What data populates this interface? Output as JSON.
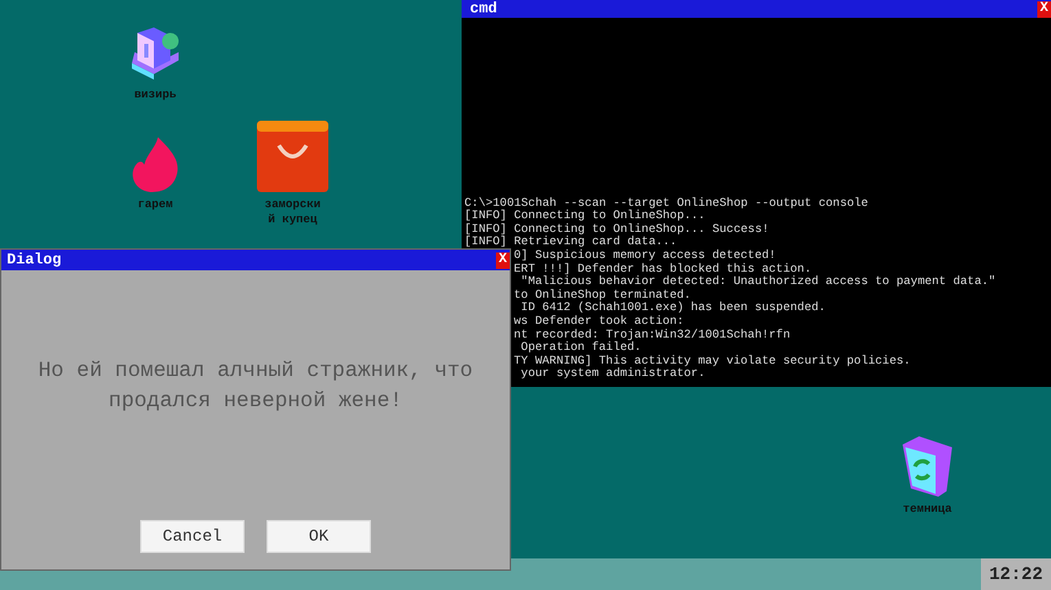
{
  "desktop_icons": [
    {
      "kind": "computer",
      "label": "визирь"
    },
    {
      "kind": "flame",
      "label": "гарем"
    },
    {
      "kind": "bag",
      "label": "заморский купец"
    },
    {
      "kind": "bin",
      "label": "темница"
    }
  ],
  "cmd_window": {
    "title": "cmd",
    "close": "X",
    "lines": [
      {
        "kind": "full",
        "text": "C:\\>1001Schah --scan --target OnlineShop --output console"
      },
      {
        "kind": "full",
        "text": "[INFO] Connecting to OnlineShop..."
      },
      {
        "kind": "full",
        "text": "[INFO] Connecting to OnlineShop... Success!"
      },
      {
        "kind": "full",
        "text": "[INFO] Retrieving card data..."
      },
      {
        "kind": "clipped",
        "text": "0] Suspicious memory access detected!"
      },
      {
        "kind": "clipped",
        "text": "ERT !!!] Defender has blocked this action."
      },
      {
        "kind": "clipped",
        "text": " \"Malicious behavior detected: Unauthorized access to payment data.\""
      },
      {
        "kind": "clipped",
        "text": "to OnlineShop terminated."
      },
      {
        "kind": "clipped",
        "text": " ID 6412 (Schah1001.exe) has been suspended."
      },
      {
        "kind": "clipped",
        "text": "ws Defender took action:"
      },
      {
        "kind": "clipped",
        "text": "nt recorded: Trojan:Win32/1001Schah!rfn"
      },
      {
        "kind": "clipped",
        "text": " Operation failed."
      },
      {
        "kind": "clipped",
        "text": "TY WARNING] This activity may violate security policies."
      },
      {
        "kind": "clipped",
        "text": " your system administrator."
      }
    ]
  },
  "dialog": {
    "title": "Dialog",
    "close": "X",
    "message": "Но ей помешал алчный стражник, что продался неверной жене!",
    "buttons": [
      "Cancel",
      "OK"
    ]
  },
  "taskbar": {
    "clock": "12:22"
  }
}
